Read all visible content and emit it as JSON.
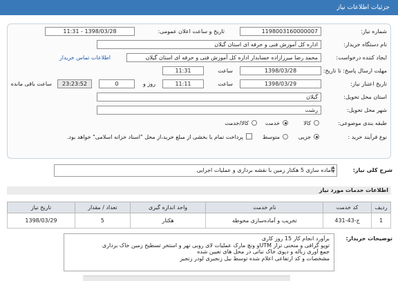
{
  "header": {
    "title": "جزئیات اطلاعات نیاز"
  },
  "form": {
    "need_number_label": "شماره نیاز:",
    "need_number": "1198003160000007",
    "announce_label": "تاریخ و ساعت اعلان عمومی:",
    "announce_value": "1398/03/28 - 11:31",
    "buyer_org_label": "نام دستگاه خریدار:",
    "buyer_org": "اداره کل آموزش فنی و حرفه ای استان گیلان",
    "creator_label": "ایجاد کننده درخواست:",
    "creator": "محمد رضا میرزازاده حسابدار اداره کل آموزش فنی و حرفه ای استان گیلان",
    "contact_link": "اطلاعات تماس خریدار",
    "reply_deadline_label": "مهلت ارسال پاسخ: تا تاریخ:",
    "reply_date": "1398/03/28",
    "time_label": "ساعت",
    "reply_time": "11:31",
    "validity_label": "تاریخ اعتبار نیاز:",
    "validity_date": "1398/03/29",
    "validity_time": "11:11",
    "day_label": "روز و",
    "days_left": "0",
    "remaining_time": "23:23:52",
    "remaining_label": "ساعت باقی مانده",
    "province_label": "استان محل تحویل:",
    "province": "گیلان",
    "city_label": "شهر محل تحویل:",
    "city": "رشت",
    "category_label": "طبقه بندی موضوعی:",
    "category_options": [
      {
        "label": "کالا",
        "selected": false
      },
      {
        "label": "خدمت",
        "selected": true
      },
      {
        "label": "کالا/خدمت",
        "selected": false
      }
    ],
    "purchase_type_label": "نوع فرآیند خرید :",
    "purchase_options": [
      {
        "label": "جزیی",
        "selected": true
      },
      {
        "label": "متوسط",
        "selected": false
      }
    ],
    "treasury_note": "پرداخت تمام یا بخشی از مبلغ خرید،از محل \"اسناد خزانه اسلامی\" خواهد بود."
  },
  "summary": {
    "label": "شرح کلی نیاز:",
    "value": "آماده سازی 5 هکتار زمین با نقشه برداری  و عملیات اجرایی"
  },
  "services": {
    "title": "اطلاعات خدمات مورد نیاز",
    "columns": [
      "ردیف",
      "کد خدمت",
      "نام خدمت",
      "واحد اندازه گیری",
      "تعداد / مقدار",
      "تاریخ نیاز"
    ],
    "rows": [
      {
        "row": "1",
        "code": "ج-43-431",
        "name": "تخریب و آماده‌سازی محوطه",
        "unit": "هکتار",
        "qty": "5",
        "date": "1398/03/29"
      }
    ]
  },
  "notes": {
    "label": "توضیحات خریدار:",
    "lines": [
      "برآورد انجام کار 15 روز کاری",
      "توپو گرافی و منحنی تراز UTMو ونچ مارک  عملیات لای روبی نهر و استخر  تسطیح زمین  خاک برداری",
      "جمع آوری زباله و دپوی خاک نباتی  در محل های تعیین شده",
      "مشخصات و کد ارتفاعی اعلام شده  توسط بیل زنجیری لودر زنجیر"
    ]
  }
}
